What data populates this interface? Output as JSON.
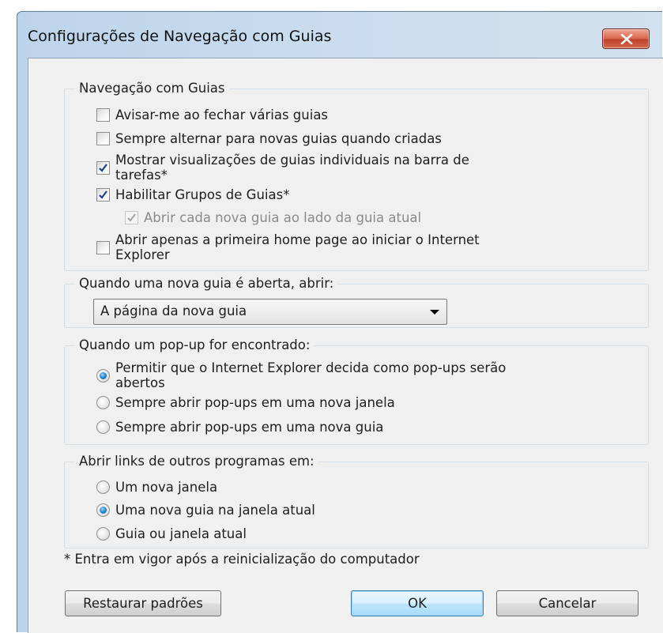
{
  "window": {
    "title": "Configurações de Navegação com Guias",
    "close_icon": "close-icon",
    "accent_close": "#c8452e"
  },
  "tabbed_browsing": {
    "legend": "Navegação com Guias",
    "options": [
      {
        "label": "Avisar-me ao fechar várias guias",
        "checked": false
      },
      {
        "label": "Sempre alternar para novas guias quando criadas",
        "checked": false
      },
      {
        "label_line1": "Mostrar visualizações de guias individuais na barra de",
        "label_line2": "tarefas*",
        "checked": true
      },
      {
        "label": "Habilitar Grupos de Guias*",
        "checked": true
      },
      {
        "label": "Abrir cada nova guia ao lado da guia atual",
        "checked": true,
        "disabled": true
      },
      {
        "label_line1": "Abrir apenas a primeira home page ao iniciar o Internet",
        "label_line2": "Explorer",
        "checked": false
      }
    ]
  },
  "new_tab": {
    "legend": "Quando uma nova guia é aberta, abrir:",
    "selected": "A página da nova guia"
  },
  "popup": {
    "legend": "Quando um pop-up for encontrado:",
    "options": [
      {
        "label_line1": "Permitir que o Internet Explorer decida como pop-ups serão",
        "label_line2": "abertos",
        "selected": true
      },
      {
        "label": "Sempre abrir pop-ups em uma nova janela",
        "selected": false
      },
      {
        "label": "Sempre abrir pop-ups em uma nova guia",
        "selected": false
      }
    ]
  },
  "links": {
    "legend": "Abrir links de outros programas em:",
    "options": [
      {
        "label": "Um nova janela",
        "selected": false
      },
      {
        "label": "Uma nova guia na janela atual",
        "selected": true
      },
      {
        "label": "Guia ou janela atual",
        "selected": false
      }
    ]
  },
  "footnote": "* Entra em vigor após a reinicialização do computador",
  "buttons": {
    "restore": "Restaurar padrões",
    "ok": "OK",
    "cancel": "Cancelar"
  }
}
